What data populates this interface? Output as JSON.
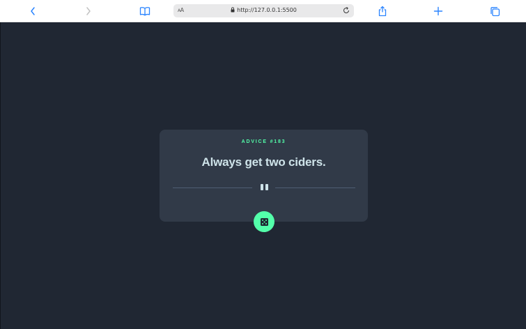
{
  "browser": {
    "url": "http://127.0.0.1:5500",
    "text_size_label_small": "A",
    "text_size_label_large": "A"
  },
  "advice": {
    "label": "ADVICE #183",
    "text": "Always get two ciders."
  },
  "colors": {
    "background": "#202733",
    "card": "#313a48",
    "accent": "#53ffaa",
    "quote_text": "#cee3e9",
    "toolbar_icon": "#2a84ff"
  },
  "icons": {
    "back": "chevron-left-icon",
    "forward": "chevron-right-icon",
    "bookmarks": "book-icon",
    "lock": "lock-icon",
    "reload": "reload-icon",
    "share": "share-icon",
    "new_tab": "plus-icon",
    "tabs": "tabs-icon",
    "divider": "pause-icon",
    "generate": "dice-icon"
  }
}
